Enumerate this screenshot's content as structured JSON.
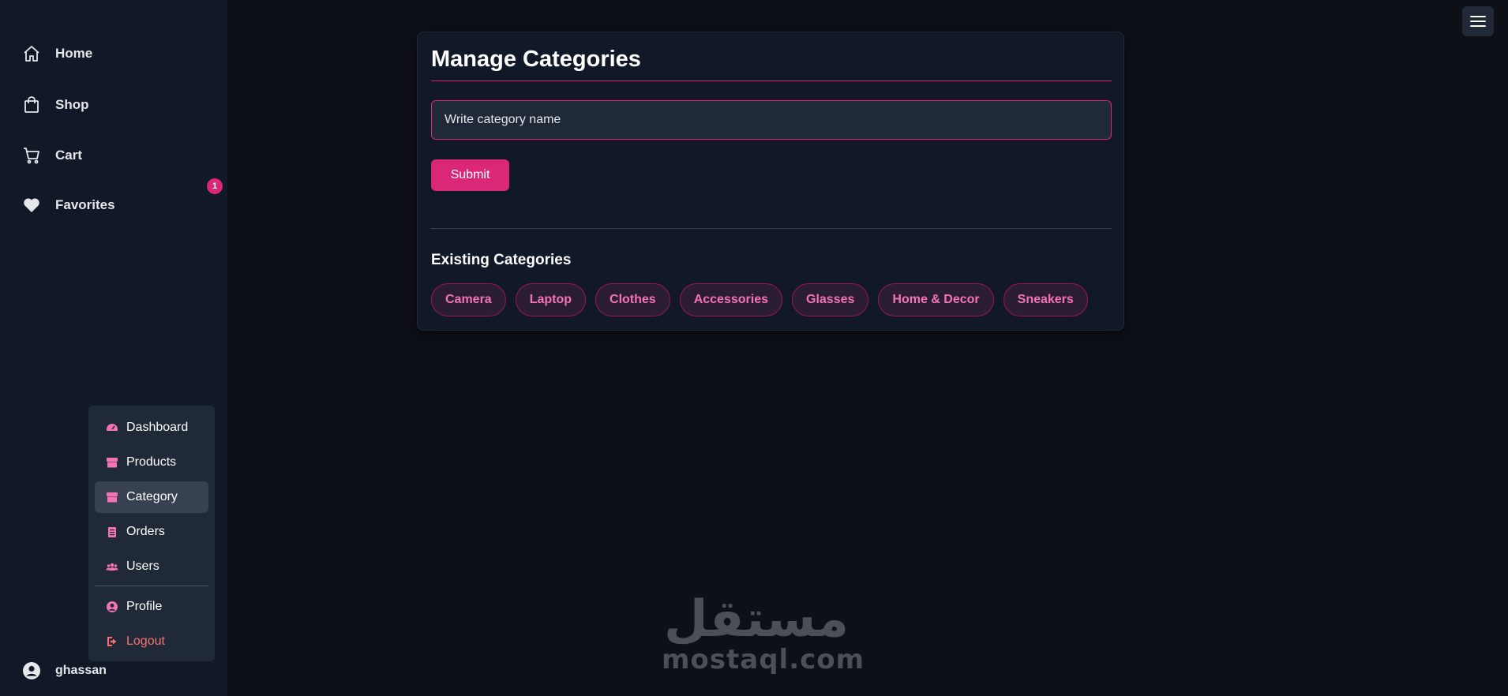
{
  "sidebar": {
    "items": [
      {
        "label": "Home",
        "icon": "home-icon"
      },
      {
        "label": "Shop",
        "icon": "shopping-bag-icon"
      },
      {
        "label": "Cart",
        "icon": "cart-icon"
      },
      {
        "label": "Favorites",
        "icon": "heart-icon"
      }
    ],
    "favorites_badge": "1",
    "username": "ghassan"
  },
  "dropdown": {
    "items": [
      {
        "label": "Dashboard",
        "icon": "dashboard-icon"
      },
      {
        "label": "Products",
        "icon": "box-icon"
      },
      {
        "label": "Category",
        "icon": "box-icon"
      },
      {
        "label": "Orders",
        "icon": "clipboard-icon"
      },
      {
        "label": "Users",
        "icon": "users-icon"
      }
    ],
    "profile_label": "Profile",
    "logout_label": "Logout",
    "active": "Category"
  },
  "main": {
    "title": "Manage Categories",
    "input_placeholder": "Write category name",
    "submit_label": "Submit",
    "existing_title": "Existing Categories",
    "categories": [
      "Camera",
      "Laptop",
      "Clothes",
      "Accessories",
      "Glasses",
      "Home & Decor",
      "Sneakers"
    ]
  },
  "watermark": {
    "arabic": "مستقل",
    "latin": "mostaql.com"
  },
  "colors": {
    "accent": "#db2777",
    "chip_text": "#f472b6",
    "background": "#0d1017",
    "sidebar": "#111827",
    "logout": "#f87171"
  }
}
